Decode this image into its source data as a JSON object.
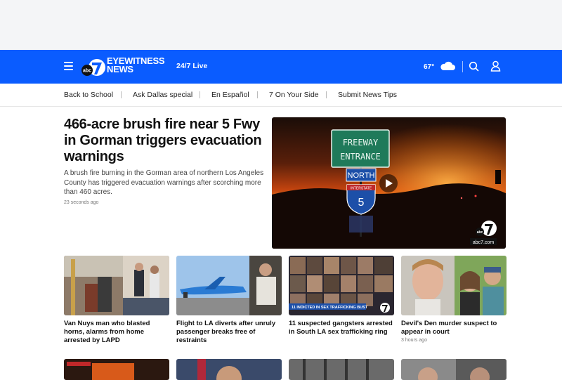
{
  "header": {
    "logo_line1": "EYEWITNESS",
    "logo_line2": "NEWS",
    "logo_badge": "abc",
    "logo_number": "7",
    "live_label": "24/7 Live",
    "temperature": "67°",
    "weather_icon": "cloud-icon",
    "brand_color": "#0a5cff"
  },
  "nav": {
    "items": [
      "Back to School",
      "Ask Dallas special",
      "En Español",
      "7 On Your Side",
      "Submit News Tips"
    ]
  },
  "top_story": {
    "headline": "466-acre brush fire near 5 Fwy in Gorman triggers evacuation warnings",
    "summary": "A brush fire burning in the Gorman area of northern Los Angeles County has triggered evacuation warnings after scorching more than 460 acres.",
    "time": "23 seconds ago",
    "sign_line1": "FREEWAY",
    "sign_line2": "ENTRANCE",
    "sign_north": "NORTH",
    "shield_top": "INTERSTATE",
    "shield_number": "5",
    "watermark": "abc7.com",
    "watermark_badge": "abc",
    "watermark_number": "7"
  },
  "cards": [
    {
      "title": "Van Nuys man who blasted horns, alarms from home arrested by LAPD",
      "time": ""
    },
    {
      "title": "Flight to LA diverts after unruly passenger breaks free of restraints",
      "time": ""
    },
    {
      "title": "11 suspected gangsters arrested in South LA sex trafficking ring",
      "time": "",
      "banner": "11 INDICTED IN SEX TRAFFICKING BUST"
    },
    {
      "title": "Devil's Den murder suspect to appear in court",
      "time": "3 hours ago"
    }
  ]
}
